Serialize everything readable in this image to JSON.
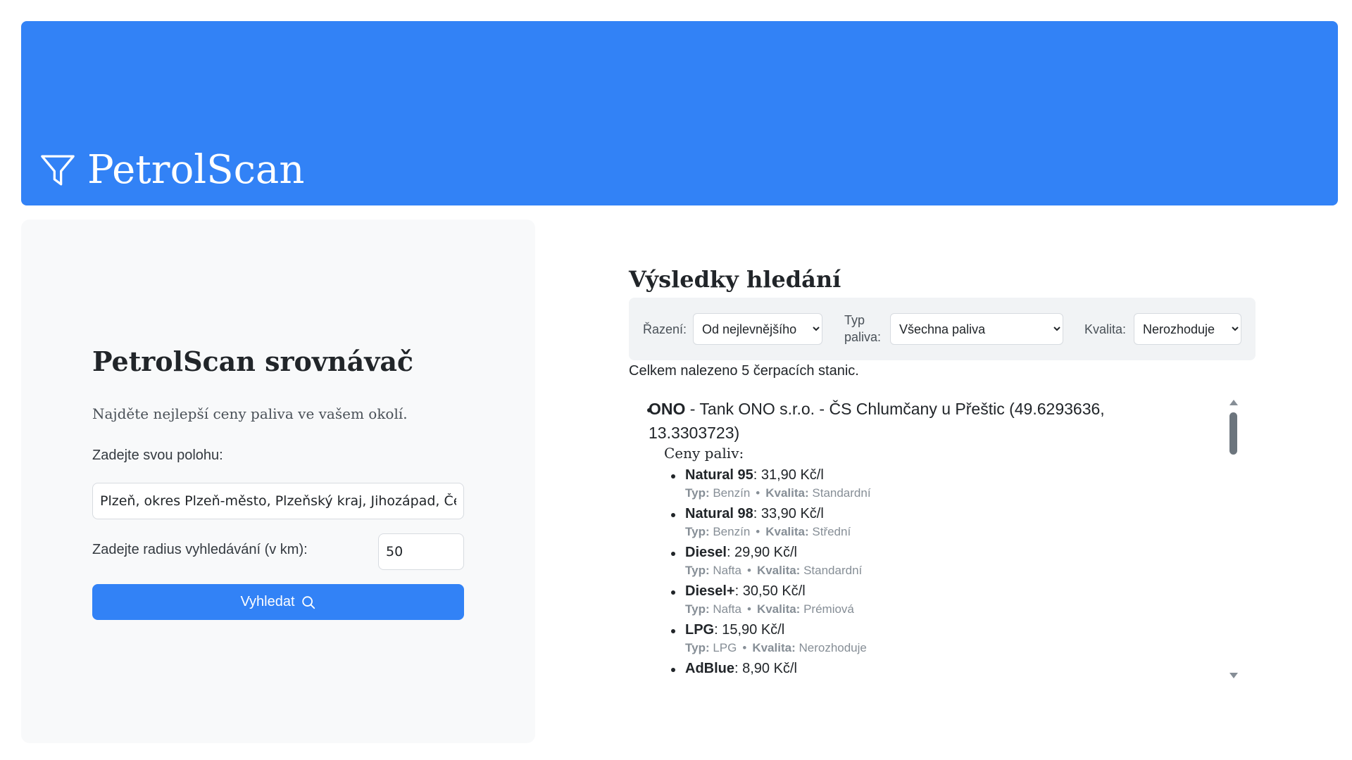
{
  "header": {
    "app_title": "PetrolScan",
    "icon": "funnel-icon",
    "color": "#3282f6"
  },
  "search_panel": {
    "title": "PetrolScan srovnávač",
    "description": "Najděte nejlepší ceny paliva ve vašem okolí.",
    "location_label": "Zadejte svou polohu:",
    "location_value": "Plzeň, okres Plzeň-město, Plzeňský kraj, Jihozápad, Česko",
    "radius_label": "Zadejte radius vyhledávání (v km):",
    "radius_value": "50",
    "search_button": "Vyhledat",
    "search_icon": "search-icon"
  },
  "results": {
    "title": "Výsledky hledání",
    "sort_label": "Řazení:",
    "sort_value": "Od nejlevnějšího",
    "fuel_type_label": "Typ paliva:",
    "fuel_type_value": "Všechna paliva",
    "quality_label": "Kvalita:",
    "quality_value": "Nerozhoduje",
    "count_text": "Celkem nalezeno 5 čerpacích stanic.",
    "station": {
      "brand": "ONO",
      "details": " - Tank ONO s.r.o. - ČS Chlumčany u Přeštic (49.6293636, 13.3303723)",
      "prices_label": "Ceny paliv:",
      "type_prefix": "Typ:",
      "quality_prefix": "Kvalita:",
      "fuels": [
        {
          "name": "Natural 95",
          "price": ": 31,90 Kč/l",
          "type": " Benzín",
          "quality": " Standardní"
        },
        {
          "name": "Natural 98",
          "price": ": 33,90 Kč/l",
          "type": " Benzín",
          "quality": " Střední"
        },
        {
          "name": "Diesel",
          "price": ": 29,90 Kč/l",
          "type": " Nafta",
          "quality": " Standardní"
        },
        {
          "name": "Diesel+",
          "price": ": 30,50 Kč/l",
          "type": " Nafta",
          "quality": " Prémiová"
        },
        {
          "name": "LPG",
          "price": ": 15,90 Kč/l",
          "type": " LPG",
          "quality": " Nerozhoduje"
        },
        {
          "name": "AdBlue",
          "price": ": 8,90 Kč/l"
        }
      ]
    }
  }
}
